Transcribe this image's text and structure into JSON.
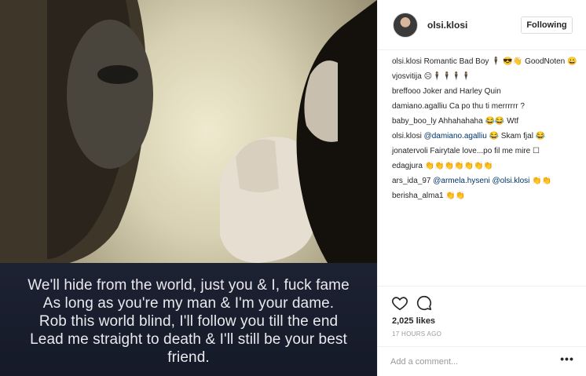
{
  "post": {
    "username": "olsi.klosi",
    "follow_label": "Following",
    "image_quote": [
      "We'll hide from the world, just you & I, fuck fame",
      "As long as you're my man & I'm your dame.",
      "Rob this world blind, I'll follow you till the end",
      "Lead me straight to death & I'll still be your best",
      "friend."
    ],
    "caption": {
      "user": "olsi.klosi",
      "text": "Romantic Bad Boy 🕴 😎👋 GoodNoten 😀"
    },
    "comments": [
      {
        "user": "vjosvitija",
        "text": "☹🕴🕴🕴🕴"
      },
      {
        "user": "breffooo",
        "text": "Joker and Harley Quin"
      },
      {
        "user": "damiano.agalliu",
        "text": "Ca po thu ti merrrrrr ?"
      },
      {
        "user": "baby_boo_ly",
        "text": "Ahhahahaha 😂😂 Wtf"
      },
      {
        "user": "olsi.klosi",
        "mention": "@damiano.agalliu",
        "text": "😂 Skam fjal 😂"
      },
      {
        "user": "jonatervoli",
        "text": "Fairytale love...po fil me mire ☐"
      },
      {
        "user": "edagjura",
        "text": "👏👏👏👏👏👏👏"
      },
      {
        "user": "ars_ida_97",
        "mention": "@armela.hyseni",
        "mention2": "@olsi.klosi",
        "text": "👏👏"
      },
      {
        "user": "berisha_alma1",
        "text": "👏👏"
      }
    ],
    "likes": "2,025 likes",
    "time": "17 HOURS AGO",
    "add_comment_placeholder": "Add a comment...",
    "more_label": "•••",
    "icons": {
      "like": "heart-icon",
      "comment": "comment-bubble-icon"
    }
  }
}
